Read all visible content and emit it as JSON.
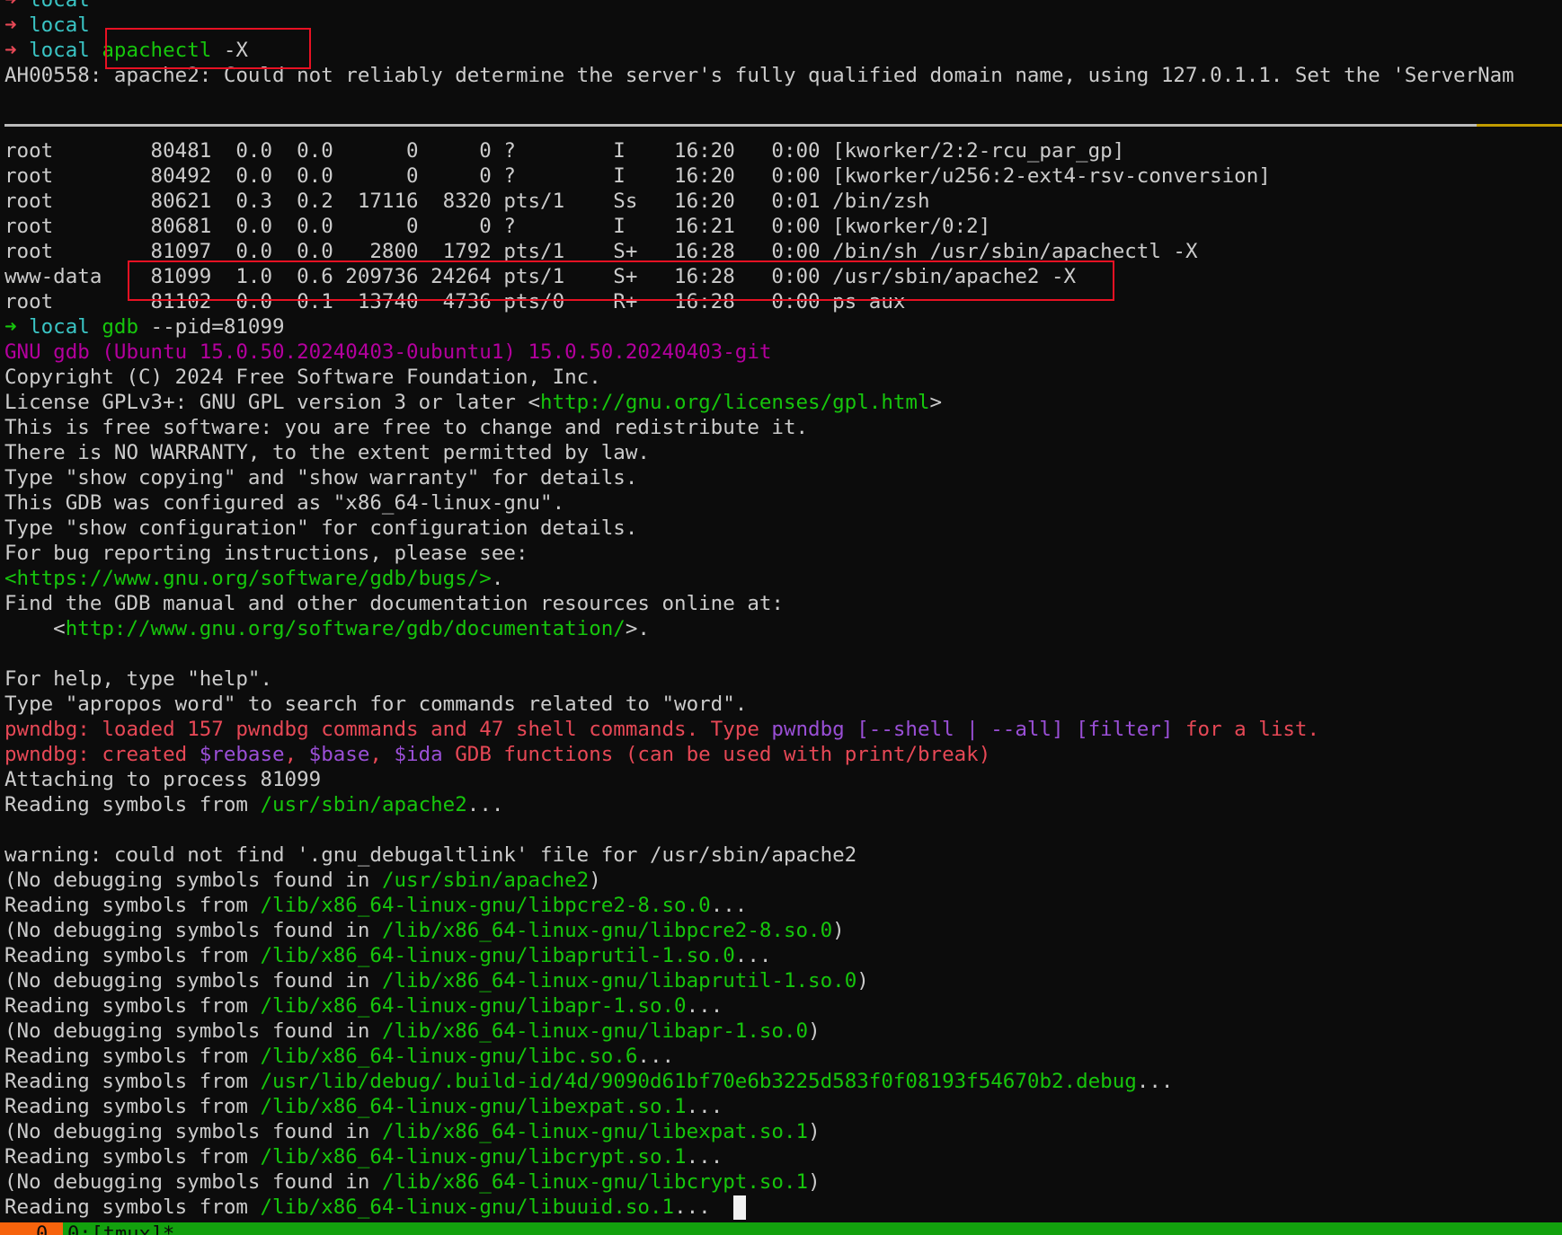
{
  "terminal": {
    "lines": [
      [
        {
          "t": "➜ ",
          "c": "red"
        },
        {
          "t": "local",
          "c": "cyan"
        }
      ],
      [
        {
          "t": "➜ ",
          "c": "red"
        },
        {
          "t": "local",
          "c": "cyan"
        }
      ],
      [
        {
          "t": "➜ ",
          "c": "red"
        },
        {
          "t": "local ",
          "c": "cyan"
        },
        {
          "t": "apachectl",
          "c": "green"
        },
        {
          "t": " -X",
          "c": "default"
        }
      ],
      [
        {
          "t": "AH00558: apache2: Could not reliably determine the server's fully qualified domain name, using 127.0.1.1. Set the 'ServerNam",
          "c": "default"
        }
      ],
      [],
      [],
      [
        {
          "t": "root        80481  0.0  0.0      0     0 ?        I    16:20   0:00 [kworker/2:2-rcu_par_gp]",
          "c": "default"
        }
      ],
      [
        {
          "t": "root        80492  0.0  0.0      0     0 ?        I    16:20   0:00 [kworker/u256:2-ext4-rsv-conversion]",
          "c": "default"
        }
      ],
      [
        {
          "t": "root        80621  0.3  0.2  17116  8320 pts/1    Ss   16:20   0:01 /bin/zsh",
          "c": "default"
        }
      ],
      [
        {
          "t": "root        80681  0.0  0.0      0     0 ?        I    16:21   0:00 [kworker/0:2]",
          "c": "default"
        }
      ],
      [
        {
          "t": "root        81097  0.0  0.0   2800  1792 pts/1    S+   16:28   0:00 /bin/sh /usr/sbin/apachectl -X",
          "c": "default"
        }
      ],
      [
        {
          "t": "www-data    81099  1.0  0.6 209736 24264 pts/1    S+   16:28   0:00 /usr/sbin/apache2 -X",
          "c": "default"
        }
      ],
      [
        {
          "t": "root        81102  0.0  0.1  13740  4736 pts/0    R+   16:28   0:00 ps aux",
          "c": "default"
        }
      ],
      [
        {
          "t": "➜ ",
          "c": "green"
        },
        {
          "t": "local ",
          "c": "cyan"
        },
        {
          "t": "gdb",
          "c": "green"
        },
        {
          "t": " --pid=81099",
          "c": "default"
        }
      ],
      [
        {
          "t": "GNU gdb (Ubuntu 15.0.50.20240403-0ubuntu1) 15.0.50.20240403-git",
          "c": "magenta"
        }
      ],
      [
        {
          "t": "Copyright (C) 2024 Free Software Foundation, Inc.",
          "c": "default"
        }
      ],
      [
        {
          "t": "License GPLv3+: GNU GPL version 3 or later <",
          "c": "default"
        },
        {
          "t": "http://gnu.org/licenses/gpl.html",
          "c": "green"
        },
        {
          "t": ">",
          "c": "default"
        }
      ],
      [
        {
          "t": "This is free software: you are free to change and redistribute it.",
          "c": "default"
        }
      ],
      [
        {
          "t": "There is NO WARRANTY, to the extent permitted by law.",
          "c": "default"
        }
      ],
      [
        {
          "t": "Type \"show copying\" and \"show warranty\" for details.",
          "c": "default"
        }
      ],
      [
        {
          "t": "This GDB was configured as \"x86_64-linux-gnu\".",
          "c": "default"
        }
      ],
      [
        {
          "t": "Type \"show configuration\" for configuration details.",
          "c": "default"
        }
      ],
      [
        {
          "t": "For bug reporting instructions, please see:",
          "c": "default"
        }
      ],
      [
        {
          "t": "<https://www.gnu.org/software/gdb/bugs/>",
          "c": "green"
        },
        {
          "t": ".",
          "c": "default"
        }
      ],
      [
        {
          "t": "Find the GDB manual and other documentation resources online at:",
          "c": "default"
        }
      ],
      [
        {
          "t": "    <",
          "c": "default"
        },
        {
          "t": "http://www.gnu.org/software/gdb/documentation/",
          "c": "green"
        },
        {
          "t": ">.",
          "c": "default"
        }
      ],
      [],
      [
        {
          "t": "For help, type \"help\".",
          "c": "default"
        }
      ],
      [
        {
          "t": "Type \"apropos word\" to search for commands related to \"word\".",
          "c": "default"
        }
      ],
      [
        {
          "t": "pwndbg: loaded 157 pwndbg commands and 47 shell commands. Type ",
          "c": "red"
        },
        {
          "t": "pwndbg [--shell | --all] [filter]",
          "c": "purple"
        },
        {
          "t": " for a list.",
          "c": "red"
        }
      ],
      [
        {
          "t": "pwndbg: created ",
          "c": "red"
        },
        {
          "t": "$rebase",
          "c": "purple"
        },
        {
          "t": ", ",
          "c": "red"
        },
        {
          "t": "$base",
          "c": "purple"
        },
        {
          "t": ", ",
          "c": "red"
        },
        {
          "t": "$ida",
          "c": "purple"
        },
        {
          "t": " GDB functions (can be used with print/break)",
          "c": "red"
        }
      ],
      [
        {
          "t": "Attaching to process 81099",
          "c": "default"
        }
      ],
      [
        {
          "t": "Reading symbols from ",
          "c": "default"
        },
        {
          "t": "/usr/sbin/apache2",
          "c": "green"
        },
        {
          "t": "...",
          "c": "default"
        }
      ],
      [],
      [
        {
          "t": "warning: could not find '.gnu_debugaltlink' file for /usr/sbin/apache2",
          "c": "default"
        }
      ],
      [
        {
          "t": "(No debugging symbols found in ",
          "c": "default"
        },
        {
          "t": "/usr/sbin/apache2",
          "c": "green"
        },
        {
          "t": ")",
          "c": "default"
        }
      ],
      [
        {
          "t": "Reading symbols from ",
          "c": "default"
        },
        {
          "t": "/lib/x86_64-linux-gnu/libpcre2-8.so.0",
          "c": "green"
        },
        {
          "t": "...",
          "c": "default"
        }
      ],
      [
        {
          "t": "(No debugging symbols found in ",
          "c": "default"
        },
        {
          "t": "/lib/x86_64-linux-gnu/libpcre2-8.so.0",
          "c": "green"
        },
        {
          "t": ")",
          "c": "default"
        }
      ],
      [
        {
          "t": "Reading symbols from ",
          "c": "default"
        },
        {
          "t": "/lib/x86_64-linux-gnu/libaprutil-1.so.0",
          "c": "green"
        },
        {
          "t": "...",
          "c": "default"
        }
      ],
      [
        {
          "t": "(No debugging symbols found in ",
          "c": "default"
        },
        {
          "t": "/lib/x86_64-linux-gnu/libaprutil-1.so.0",
          "c": "green"
        },
        {
          "t": ")",
          "c": "default"
        }
      ],
      [
        {
          "t": "Reading symbols from ",
          "c": "default"
        },
        {
          "t": "/lib/x86_64-linux-gnu/libapr-1.so.0",
          "c": "green"
        },
        {
          "t": "...",
          "c": "default"
        }
      ],
      [
        {
          "t": "(No debugging symbols found in ",
          "c": "default"
        },
        {
          "t": "/lib/x86_64-linux-gnu/libapr-1.so.0",
          "c": "green"
        },
        {
          "t": ")",
          "c": "default"
        }
      ],
      [
        {
          "t": "Reading symbols from ",
          "c": "default"
        },
        {
          "t": "/lib/x86_64-linux-gnu/libc.so.6",
          "c": "green"
        },
        {
          "t": "...",
          "c": "default"
        }
      ],
      [
        {
          "t": "Reading symbols from ",
          "c": "default"
        },
        {
          "t": "/usr/lib/debug/.build-id/4d/9090d61bf70e6b3225d583f0f08193f54670b2.debug",
          "c": "green"
        },
        {
          "t": "...",
          "c": "default"
        }
      ],
      [
        {
          "t": "Reading symbols from ",
          "c": "default"
        },
        {
          "t": "/lib/x86_64-linux-gnu/libexpat.so.1",
          "c": "green"
        },
        {
          "t": "...",
          "c": "default"
        }
      ],
      [
        {
          "t": "(No debugging symbols found in ",
          "c": "default"
        },
        {
          "t": "/lib/x86_64-linux-gnu/libexpat.so.1",
          "c": "green"
        },
        {
          "t": ")",
          "c": "default"
        }
      ],
      [
        {
          "t": "Reading symbols from ",
          "c": "default"
        },
        {
          "t": "/lib/x86_64-linux-gnu/libcrypt.so.1",
          "c": "green"
        },
        {
          "t": "...",
          "c": "default"
        }
      ],
      [
        {
          "t": "(No debugging symbols found in ",
          "c": "default"
        },
        {
          "t": "/lib/x86_64-linux-gnu/libcrypt.so.1",
          "c": "green"
        },
        {
          "t": ")",
          "c": "default"
        }
      ],
      [
        {
          "t": "Reading symbols from ",
          "c": "default"
        },
        {
          "t": "/lib/x86_64-linux-gnu/libuuid.so.1",
          "c": "green"
        },
        {
          "t": "...",
          "c": "default"
        }
      ]
    ]
  },
  "status_bar": {
    "session": "0",
    "window": "0:[tmux]*"
  },
  "colors": {
    "background": "#0c0c0c",
    "text": "#cccccc",
    "prompt_arrow": "#e74856",
    "prompt_host": "#3ac4c4",
    "command": "#16c60c",
    "gdb_banner": "#b4009e",
    "pwndbg_text": "#e74856",
    "pwndbg_keyword": "#9a4fd6",
    "highlight_box": "#e81123",
    "status_bar": "#13a10e",
    "status_session": "#f7630c"
  }
}
